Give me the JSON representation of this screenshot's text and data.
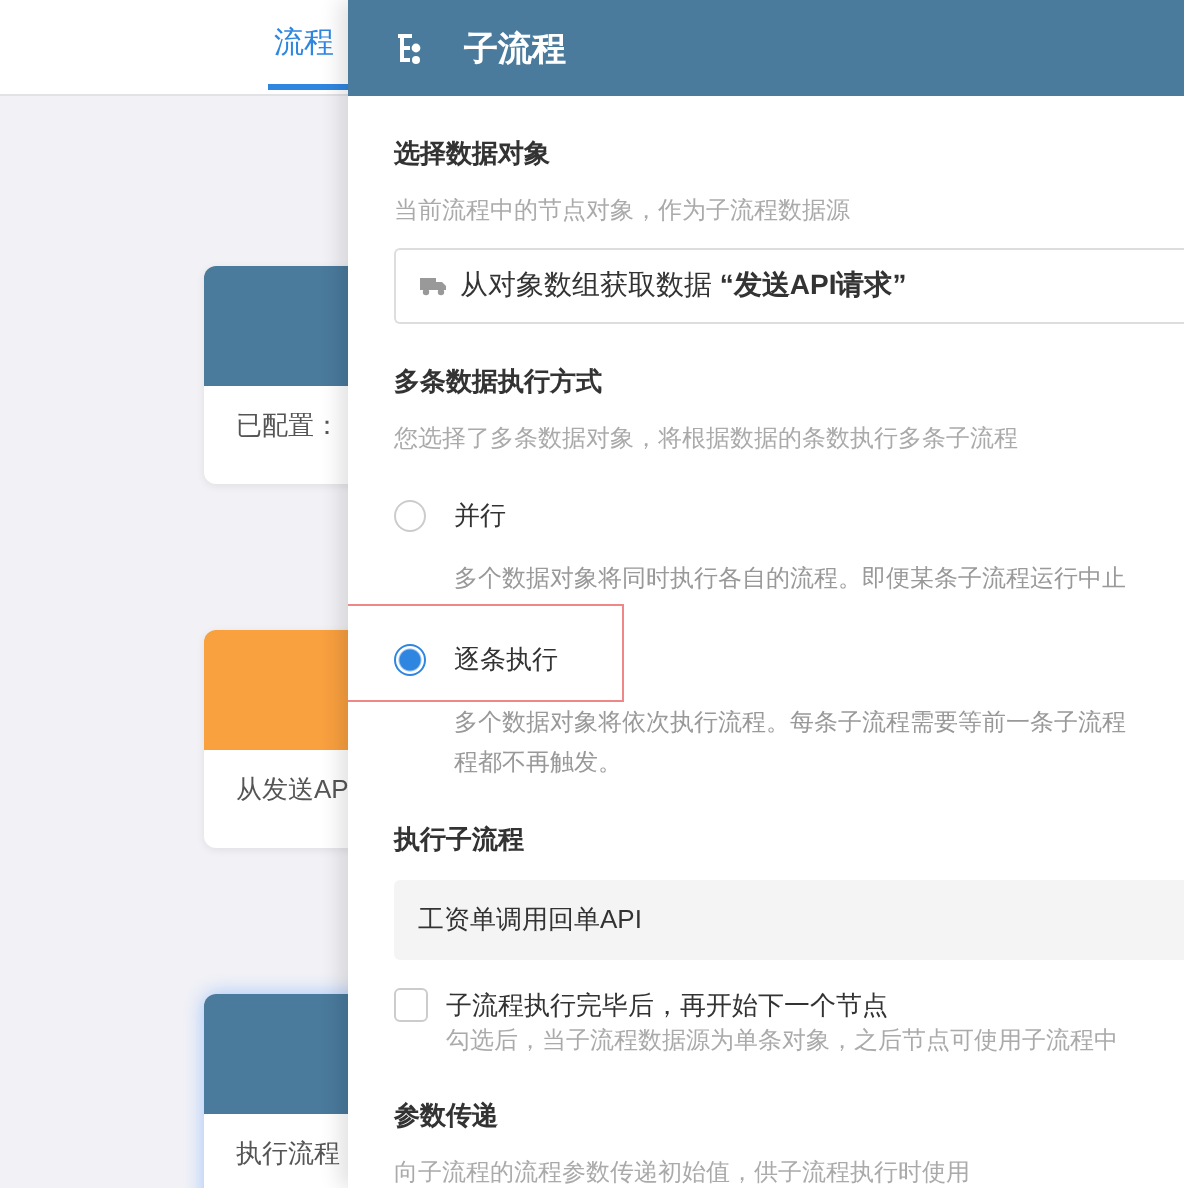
{
  "background": {
    "tabs": [
      {
        "label": "流程",
        "selected": true
      }
    ],
    "cards": [
      {
        "color": "#4a7a9c",
        "text": "已配置：",
        "focused": false
      },
      {
        "color": "#f9a03f",
        "text": "从发送AP",
        "focused": false
      },
      {
        "color": "#4a7a9c",
        "text": "执行流程",
        "focused": true
      }
    ]
  },
  "panel": {
    "title": "子流程",
    "sections": [
      {
        "kind": "source",
        "title": "选择数据对象",
        "description": "当前流程中的节点对象，作为子流程数据源",
        "value": "从对象数组获取数据 **“发送API请求”**"
      },
      {
        "kind": "radios",
        "title": "多条数据执行方式",
        "description": "您选择了多条数据对象，将根据数据的条数执行多条子流程",
        "options": [
          {
            "label": "并行",
            "selected": false,
            "description_lines": [
              "多个数据对象将同时执行各自的流程。即便某条子流程运行中止"
            ]
          },
          {
            "label": "逐条执行",
            "selected": true,
            "highlighted": true,
            "description_lines": [
              "多个数据对象将依次执行流程。每条子流程需要等前一条子流程",
              "程都不再触发。"
            ]
          }
        ]
      },
      {
        "kind": "select",
        "title": "执行子流程",
        "value": "工资单调用回单API",
        "checkbox": {
          "label": "子流程执行完毕后，再开始下一个节点",
          "checked": false,
          "hint": "勾选后，当子流程数据源为单条对象，之后节点可使用子流程中"
        }
      },
      {
        "kind": "text",
        "title": "参数传递",
        "description": "向子流程的流程参数传递初始值，供子流程执行时使用"
      }
    ]
  }
}
